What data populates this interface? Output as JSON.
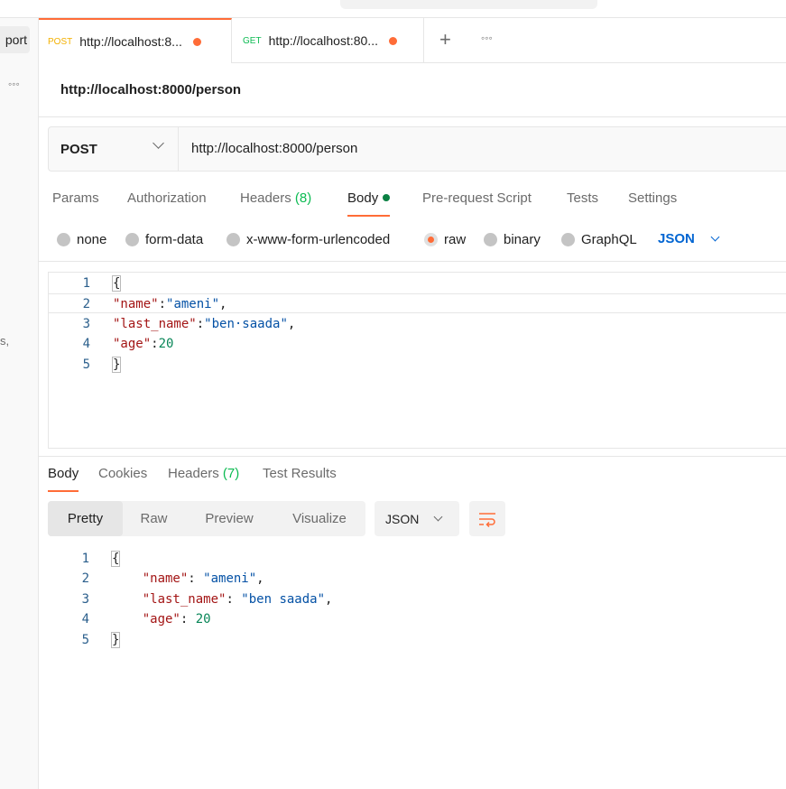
{
  "sidebar": {
    "import_label": "port",
    "more_label": "◦◦◦",
    "fragment": "s,"
  },
  "tabs": [
    {
      "method": "POST",
      "url": "http://localhost:8...",
      "unsaved": true
    },
    {
      "method": "GET",
      "url": "http://localhost:80...",
      "unsaved": true
    }
  ],
  "tabbar": {
    "new_tab": "+",
    "more": "◦◦◦"
  },
  "request": {
    "name": "http://localhost:8000/person",
    "method": "POST",
    "url": "http://localhost:8000/person"
  },
  "request_tabs": {
    "params": "Params",
    "authorization": "Authorization",
    "headers": "Headers",
    "headers_count": "(8)",
    "body": "Body",
    "prerequest": "Pre-request Script",
    "tests": "Tests",
    "settings": "Settings"
  },
  "body_types": {
    "none": "none",
    "form_data": "form-data",
    "urlencoded": "x-www-form-urlencoded",
    "raw": "raw",
    "binary": "binary",
    "graphql": "GraphQL",
    "language": "JSON",
    "selected": "raw"
  },
  "request_body": {
    "line_numbers": [
      "1",
      "2",
      "3",
      "4",
      "5"
    ],
    "open_brace": "{",
    "name_key": "\"name\"",
    "name_value": "\"ameni\"",
    "last_name_key": "\"last_name\"",
    "last_name_value": "\"ben·saada\"",
    "age_key": "\"age\"",
    "age_value": "20",
    "close_brace": "}"
  },
  "response_tabs": {
    "body": "Body",
    "cookies": "Cookies",
    "headers": "Headers",
    "headers_count": "(7)",
    "test_results": "Test Results"
  },
  "response_view": {
    "pretty": "Pretty",
    "raw": "Raw",
    "preview": "Preview",
    "visualize": "Visualize",
    "format": "JSON"
  },
  "response_body": {
    "line_numbers": [
      "1",
      "2",
      "3",
      "4",
      "5"
    ],
    "open_brace": "{",
    "name_key": "\"name\"",
    "name_value": "\"ameni\"",
    "last_name_key": "\"last_name\"",
    "last_name_value": "\"ben saada\"",
    "age_key": "\"age\"",
    "age_value": "20",
    "close_brace": "}"
  },
  "colors": {
    "accent": "#ff6c37",
    "post_method": "#f3b000",
    "get_method": "#0cbb52",
    "json_link": "#0265d2",
    "body_dot": "#0a8043"
  }
}
